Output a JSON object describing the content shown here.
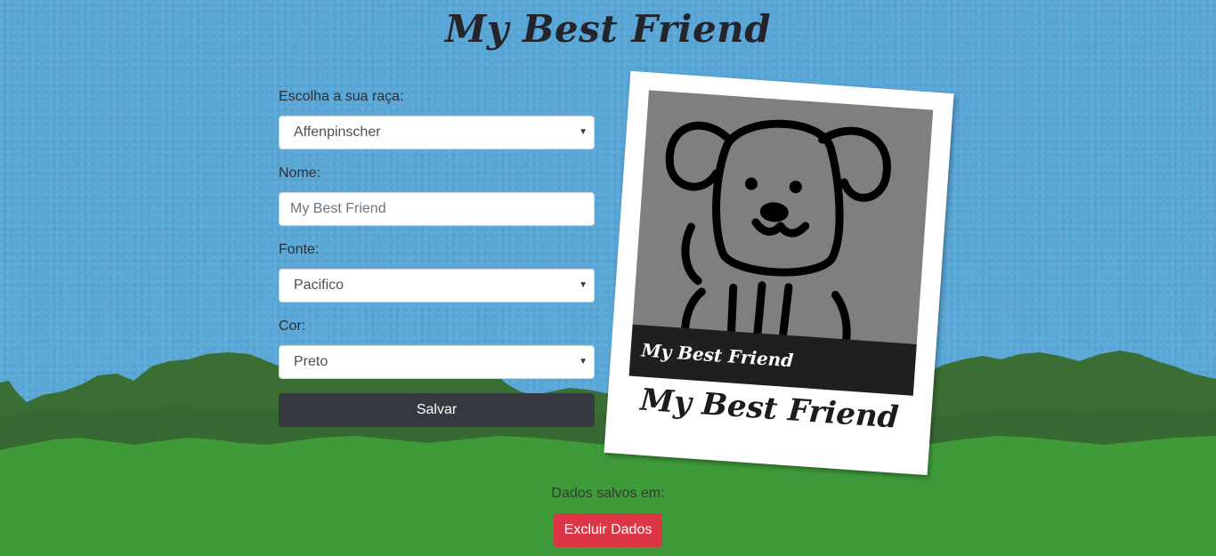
{
  "header": {
    "title": "My Best Friend"
  },
  "form": {
    "breed_label": "Escolha a sua raça:",
    "breed_value": "Affenpinscher",
    "name_label": "Nome:",
    "name_placeholder": "My Best Friend",
    "font_label": "Fonte:",
    "font_value": "Pacifico",
    "color_label": "Cor:",
    "color_value": "Preto",
    "save_label": "Salvar"
  },
  "preview": {
    "photo_caption": "My Best Friend",
    "card_caption": "My Best Friend",
    "image_icon": "dog-icon"
  },
  "footer": {
    "saved_text": "Dados salvos em:",
    "delete_label": "Excluir Dados"
  },
  "colors": {
    "sky": "#59a6d6",
    "grass": "#3f9b3a",
    "bushes": "#3b6e34",
    "save_button": "#343a40",
    "delete_button": "#dc3545"
  }
}
